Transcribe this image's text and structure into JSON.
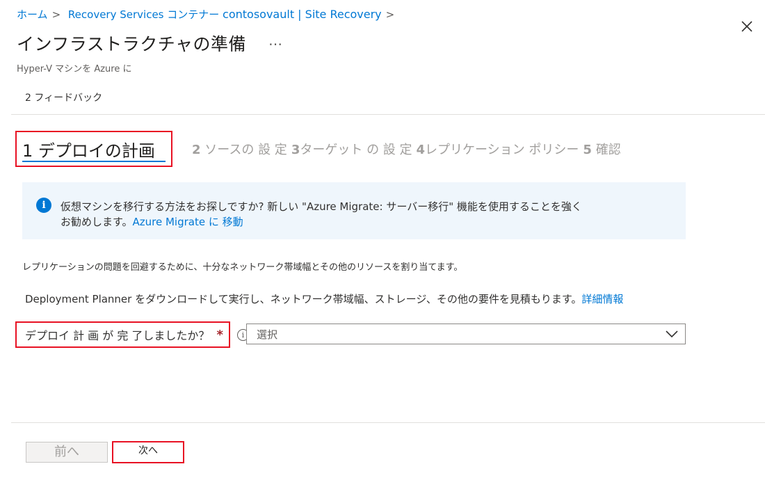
{
  "breadcrumb": {
    "items": [
      "ホーム",
      "Recovery Services コンテナー",
      "contosovault | Site Recovery"
    ],
    "separator": ">"
  },
  "header": {
    "title": "インフラストラクチャの準備",
    "more": "…",
    "subtitle": "Hyper-V マシンを Azure に"
  },
  "feedback": "2 フィードバック",
  "tabs": {
    "active": "1 デプロイの計画",
    "others": [
      {
        "num": "2",
        "label": "ソースの 設 定"
      },
      {
        "num": "3",
        "label": "ターゲット の 設 定"
      },
      {
        "num": "4",
        "label": "レプリケーション ポリシー"
      },
      {
        "num": "5",
        "label": "確認"
      }
    ]
  },
  "info": {
    "icon": "info-icon",
    "line1": "仮想マシンを移行する方法をお探しですか? 新しい \"Azure Migrate: サーバー移行\" 機能を使用することを強く",
    "line2_text": "お勧めします。",
    "line2_link": "Azure Migrate に 移動"
  },
  "para1": "レプリケーションの問題を回避するために、十分なネットワーク帯域幅とその他のリソースを割り当てます。",
  "para2": {
    "text": "Deployment Planner をダウンロードして実行し、ネットワーク帯域幅、ストレージ、その他の要件を見積もります。",
    "link": "詳細情報"
  },
  "question": {
    "label": "デプロイ 計 画 が 完 了しましたか？",
    "required": "*",
    "select_value": "選択"
  },
  "footer": {
    "prev": "前へ",
    "next": "次へ"
  },
  "colors": {
    "accent": "#0078d4",
    "highlight": "#e81123",
    "info_bg": "#eff6fc"
  }
}
